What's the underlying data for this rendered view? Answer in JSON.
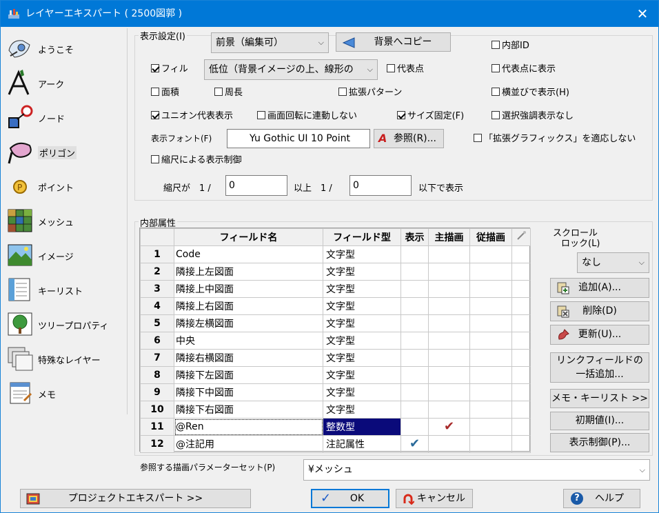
{
  "window": {
    "title": "レイヤーエキスパート ( 2500図郭 )",
    "close": "✕"
  },
  "sidebar": {
    "items": [
      {
        "label": "ようこそ"
      },
      {
        "label": "アーク"
      },
      {
        "label": "ノード"
      },
      {
        "label": "ポリゴン"
      },
      {
        "label": "ポイント"
      },
      {
        "label": "メッシュ"
      },
      {
        "label": "イメージ"
      },
      {
        "label": "キーリスト"
      },
      {
        "label": "ツリープロパティ"
      },
      {
        "label": "特殊なレイヤー"
      },
      {
        "label": "メモ"
      }
    ]
  },
  "display": {
    "group_title": "表示設定(I)",
    "mode_value": "前景（編集可）",
    "copy_button": "背景へコピー",
    "fill_label": "フィル",
    "fill_value": "低位（背景イメージの上、線形の",
    "rep_point": "代表点",
    "internal_id": "内部ID",
    "rep_point_show": "代表点に表示",
    "area": "面積",
    "perimeter": "周長",
    "ext_pattern": "拡張パターン",
    "side_by_side": "横並びで表示(H)",
    "union": "ユニオン代表表示",
    "no_rotate": "画面回転に連動しない",
    "fixed_size": "サイズ固定(F)",
    "no_highlight": "選択強調表示なし",
    "font_label": "表示フォント(F)",
    "font_value": "Yu Gothic UI 10 Point",
    "browse_button": "参照(R)...",
    "no_ext_graphics": "「拡張グラフィックス」を適応しない",
    "scale_control": "縮尺による表示制御",
    "scale_prefix": "縮尺が　1 /",
    "scale_min": "0",
    "scale_mid": "以上　1 /",
    "scale_max": "0",
    "scale_suffix": "以下で表示"
  },
  "attributes": {
    "group_title": "内部属性",
    "headers": [
      "フィールド名",
      "フィールド型",
      "表示",
      "主描画",
      "従描画"
    ],
    "rows": [
      {
        "num": "1",
        "name": "Code",
        "type": "文字型"
      },
      {
        "num": "2",
        "name": "隣接上左図面",
        "type": "文字型"
      },
      {
        "num": "3",
        "name": "隣接上中図面",
        "type": "文字型"
      },
      {
        "num": "4",
        "name": "隣接上右図面",
        "type": "文字型"
      },
      {
        "num": "5",
        "name": "隣接左横図面",
        "type": "文字型"
      },
      {
        "num": "6",
        "name": "中央",
        "type": "文字型"
      },
      {
        "num": "7",
        "name": "隣接右横図面",
        "type": "文字型"
      },
      {
        "num": "8",
        "name": "隣接下左図面",
        "type": "文字型"
      },
      {
        "num": "9",
        "name": "隣接下中図面",
        "type": "文字型"
      },
      {
        "num": "10",
        "name": "隣接下右図面",
        "type": "文字型"
      },
      {
        "num": "11",
        "name": "@Ren",
        "type": "整数型"
      },
      {
        "num": "12",
        "name": "@注記用",
        "type": "注記属性"
      }
    ],
    "check_mark": "✔",
    "scroll_lock_label_1": "スクロール",
    "scroll_lock_label_2": "ロック(L)",
    "scroll_lock_value": "なし",
    "add_button": "追加(A)...",
    "delete_button": "削除(D)",
    "update_button": "更新(U)...",
    "link_button_1": "リンクフィールドの",
    "link_button_2": "一括追加...",
    "memo_button": "メモ・キーリスト >>",
    "default_button": "初期値(I)...",
    "display_control_button": "表示制御(P)..."
  },
  "param_set": {
    "label": "参照する描画パラメーターセット(P)",
    "value": "¥メッシュ"
  },
  "footer": {
    "project_button": "プロジェクトエキスパート >>",
    "ok_button": "OK",
    "cancel_button": "キャンセル",
    "help_button": "ヘルプ"
  }
}
